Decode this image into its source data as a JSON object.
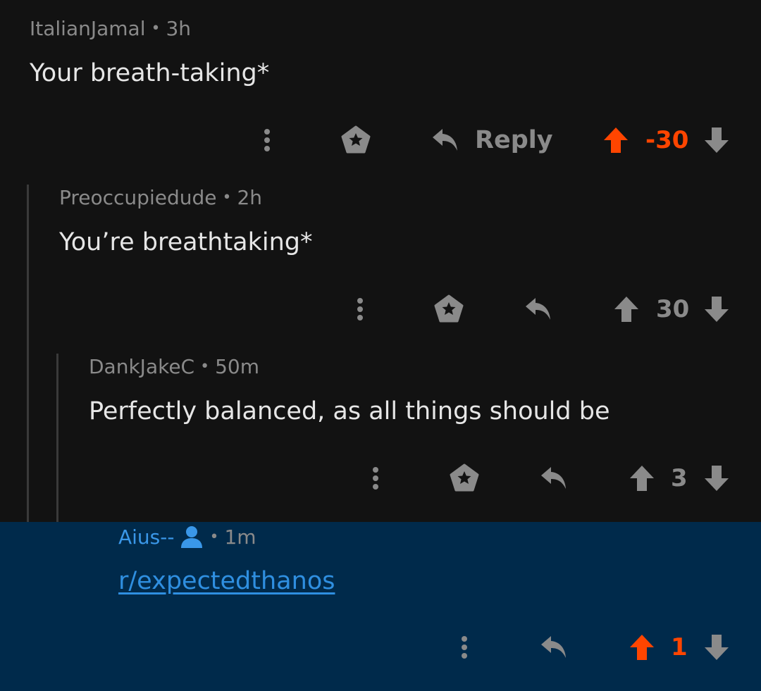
{
  "comments": [
    {
      "author": "ItalianJamal",
      "separator": "•",
      "age": "3h",
      "body": "Your breath-taking*",
      "reply_label": "Reply",
      "score": "-30",
      "icons": [
        "more-icon",
        "award-icon",
        "reply-icon",
        "upvote-icon",
        "downvote-icon"
      ]
    },
    {
      "author": "Preoccupiedude",
      "separator": "•",
      "age": "2h",
      "body": "You’re breathtaking*",
      "score": "30"
    },
    {
      "author": "DankJakeC",
      "separator": "•",
      "age": "50m",
      "body": "Perfectly balanced, as all things should be",
      "score": "3"
    },
    {
      "author": "Aius--",
      "separator": "•",
      "age": "1m",
      "body": "r/expectedthanos",
      "score": "1"
    }
  ],
  "colors": {
    "background": "#121212",
    "highlight_background": "#002a4b",
    "upvote": "#ff4500",
    "muted": "#8a8a8a",
    "link": "#2f8fe0"
  }
}
